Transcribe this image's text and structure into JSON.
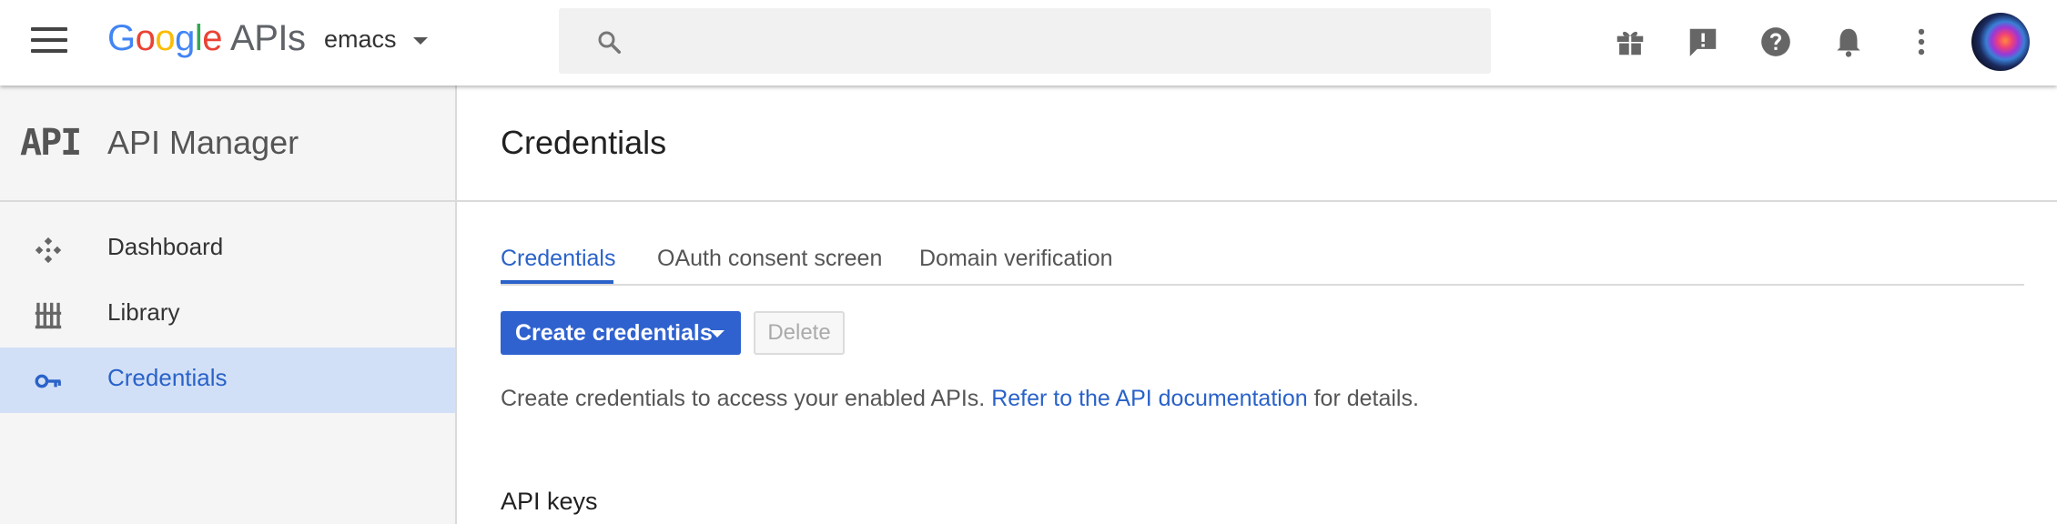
{
  "header": {
    "logo": {
      "letters": [
        "G",
        "o",
        "o",
        "g",
        "l",
        "e"
      ],
      "suffix": "APIs"
    },
    "project": "emacs",
    "icons": [
      "gift-icon",
      "feedback-icon",
      "help-icon",
      "notifications-icon",
      "more-vert-icon"
    ]
  },
  "sidebar": {
    "logo_text": "API",
    "title": "API Manager",
    "items": [
      {
        "label": "Dashboard",
        "icon": "dashboard-icon",
        "active": false
      },
      {
        "label": "Library",
        "icon": "library-icon",
        "active": false
      },
      {
        "label": "Credentials",
        "icon": "key-icon",
        "active": true
      }
    ]
  },
  "main": {
    "title": "Credentials",
    "tabs": [
      {
        "label": "Credentials",
        "active": true
      },
      {
        "label": "OAuth consent screen",
        "active": false
      },
      {
        "label": "Domain verification",
        "active": false
      }
    ],
    "create_button": "Create credentials",
    "delete_button": "Delete",
    "description": {
      "before": "Create credentials to access your enabled APIs.",
      "link": "Refer to the API documentation",
      "after": "for details."
    },
    "section_title": "API keys"
  },
  "colors": {
    "accent": "#2f62cf",
    "active_nav_bg": "#d2e0f7"
  }
}
